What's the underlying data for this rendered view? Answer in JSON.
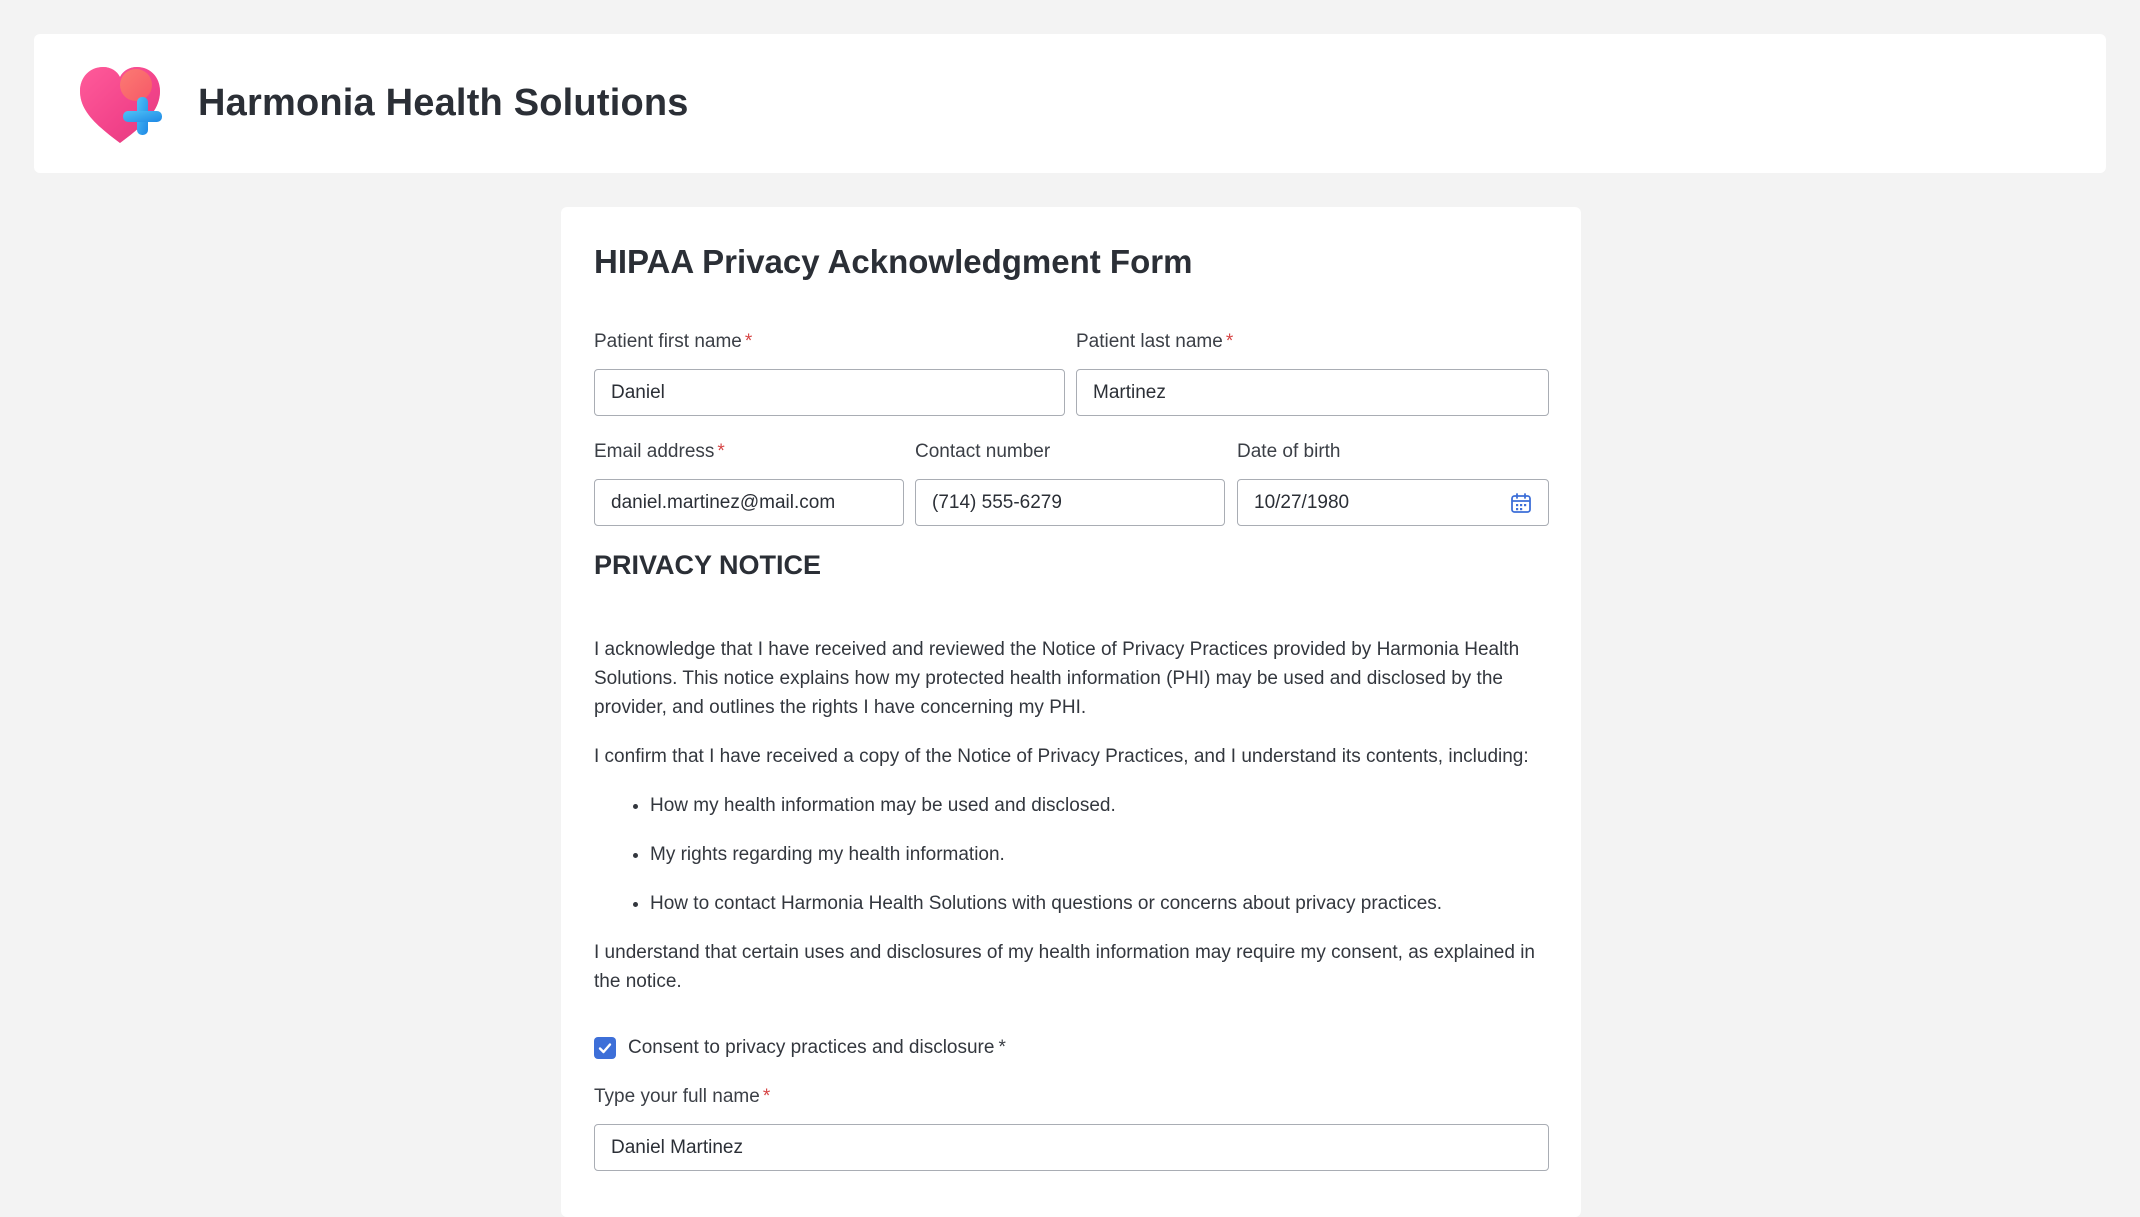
{
  "header": {
    "brand": "Harmonia Health Solutions",
    "logo_icon": "heart-plus-icon"
  },
  "form": {
    "title": "HIPAA Privacy Acknowledgment Form",
    "fields": {
      "first_name": {
        "label": "Patient first name",
        "required_mark": "*",
        "value": "Daniel"
      },
      "last_name": {
        "label": "Patient last name",
        "required_mark": "*",
        "value": "Martinez"
      },
      "email": {
        "label": "Email address",
        "required_mark": "*",
        "value": "daniel.martinez@mail.com"
      },
      "contact": {
        "label": "Contact number",
        "value": "(714) 555-6279"
      },
      "dob": {
        "label": "Date of birth",
        "value": "10/27/1980",
        "icon": "calendar-icon"
      }
    },
    "section_title": "PRIVACY NOTICE",
    "notice": {
      "p1": "I acknowledge that I have received and reviewed the Notice of Privacy Practices provided by Harmonia Health Solutions. This notice explains how my protected health information (PHI) may be used and disclosed by the provider, and outlines the rights I have concerning my PHI.",
      "p2": "I confirm that I have received a copy of the Notice of Privacy Practices, and I understand its contents, including:",
      "bullets": [
        "How my health information may be used and disclosed.",
        "My rights regarding my health information.",
        "How to contact Harmonia Health Solutions with questions or concerns about privacy practices."
      ],
      "p3": "I understand that certain uses and disclosures of my health information may require my consent, as explained in the notice."
    },
    "consent": {
      "label": "Consent to privacy practices and disclosure",
      "required_mark": "*",
      "checked": true
    },
    "full_name": {
      "label": "Type your full name",
      "required_mark": "*",
      "value": "Daniel Martinez"
    }
  },
  "colors": {
    "accent": "#3d6fd8",
    "required": "#d64545",
    "background": "#f3f3f3"
  }
}
